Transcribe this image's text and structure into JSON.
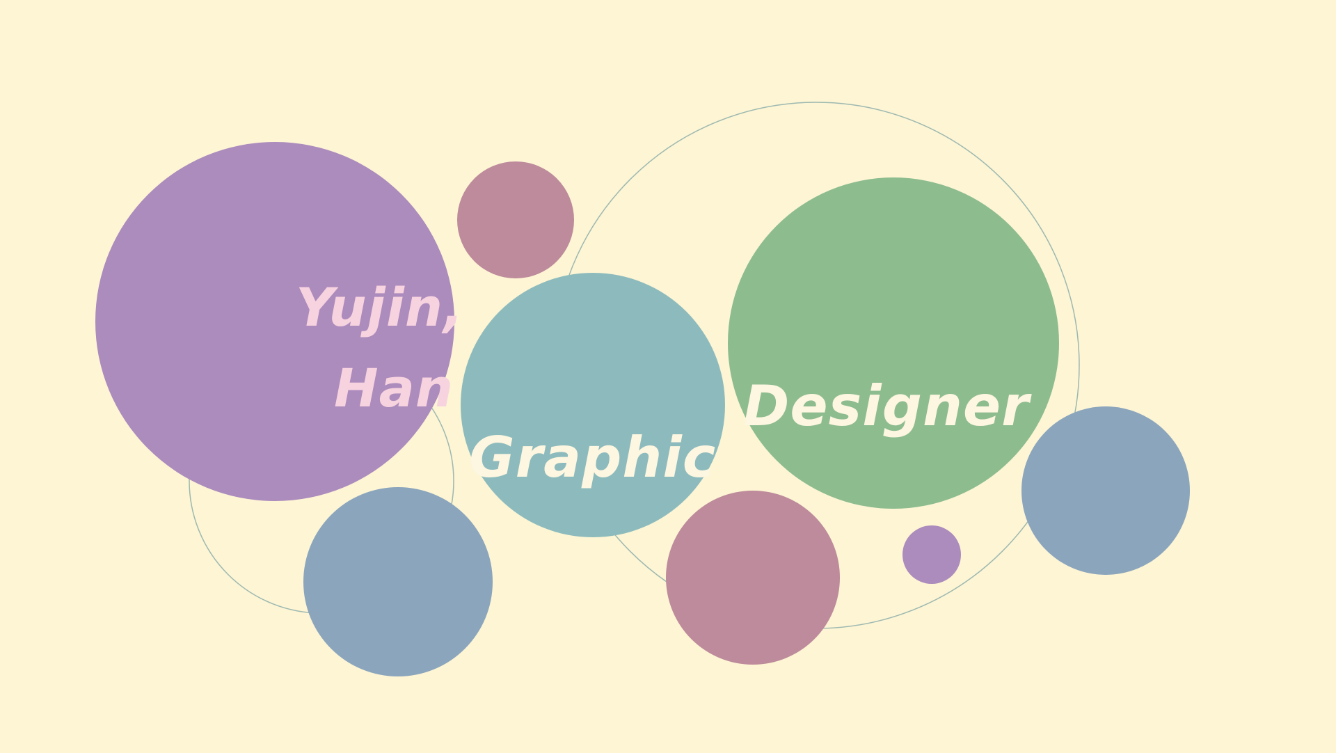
{
  "name": {
    "line1": "Yujin,",
    "line2": "Han"
  },
  "role": {
    "word1": "Graphic",
    "word2": "Designer"
  },
  "colors": {
    "background": "#fdf5d4",
    "purple": "#ac8bbd",
    "mauve": "#bd8b9b",
    "teal": "#8dbbbd",
    "green": "#8dbc8f",
    "slate_blue": "#8ba5bd",
    "outline": "#9db8b0",
    "name_text": "#f7d3df",
    "role_text": "#fdf6e0"
  }
}
